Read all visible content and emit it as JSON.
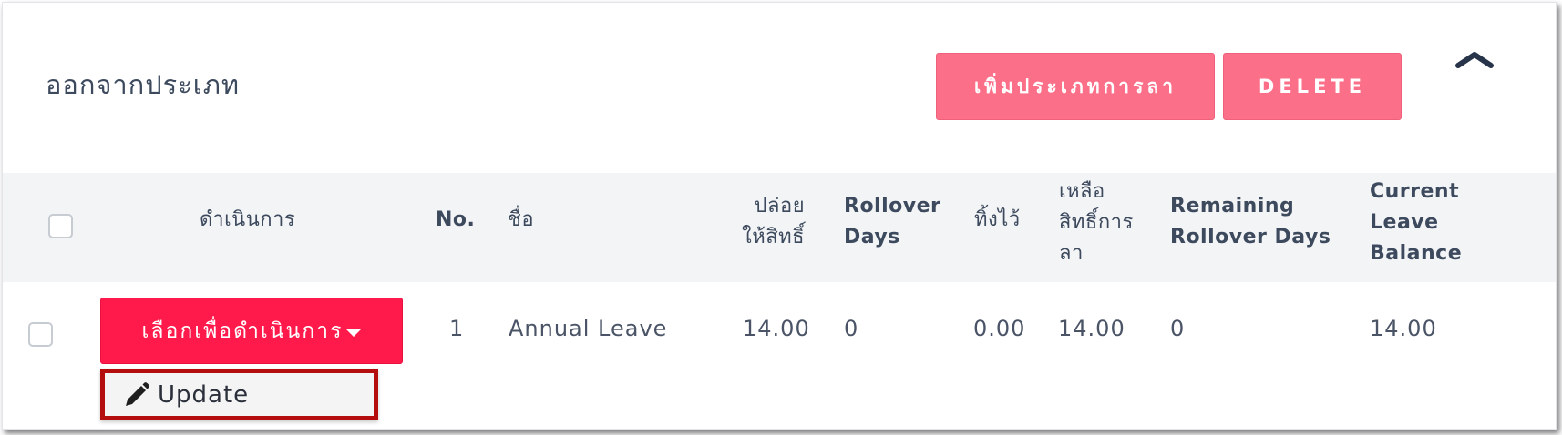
{
  "section": {
    "title": "ออกจากประเภท",
    "add_button": "เพิ่มประเภทการลา",
    "delete_button": "DELETE",
    "collapse_icon": "chevron-up-icon"
  },
  "table": {
    "headers": {
      "action": "ดำเนินการ",
      "no": "No.",
      "name": "ชื่อ",
      "entitled": [
        "ปล่อย",
        "ให้สิทธิ์"
      ],
      "rollover_days": [
        "Rollover",
        "Days"
      ],
      "left_aside": "ทิ้งไว้",
      "remaining_entitlement": [
        "เหลือ",
        "สิทธิ์การ",
        "ลา"
      ],
      "remaining_rollover_days": [
        "Remaining",
        "Rollover Days"
      ],
      "current_leave_balance": [
        "Current",
        "Leave",
        "Balance"
      ]
    },
    "rows": [
      {
        "action_button": "เลือกเพื่อดำเนินการ",
        "no": "1",
        "name": "Annual Leave",
        "entitled": "14.00",
        "rollover_days": "0",
        "left_aside": "0.00",
        "remaining_entitlement": "14.00",
        "remaining_rollover_days": "0",
        "current_leave_balance": "14.00"
      }
    ]
  },
  "dropdown": {
    "items": [
      {
        "label": "Update",
        "icon": "pencil-icon"
      }
    ]
  },
  "colors": {
    "accent_light": "#fb6f88",
    "accent_strong": "#ff1a4b",
    "highlight_border": "#b30d0d",
    "header_bg": "#f3f4f6",
    "text": "#3d4a5e"
  }
}
